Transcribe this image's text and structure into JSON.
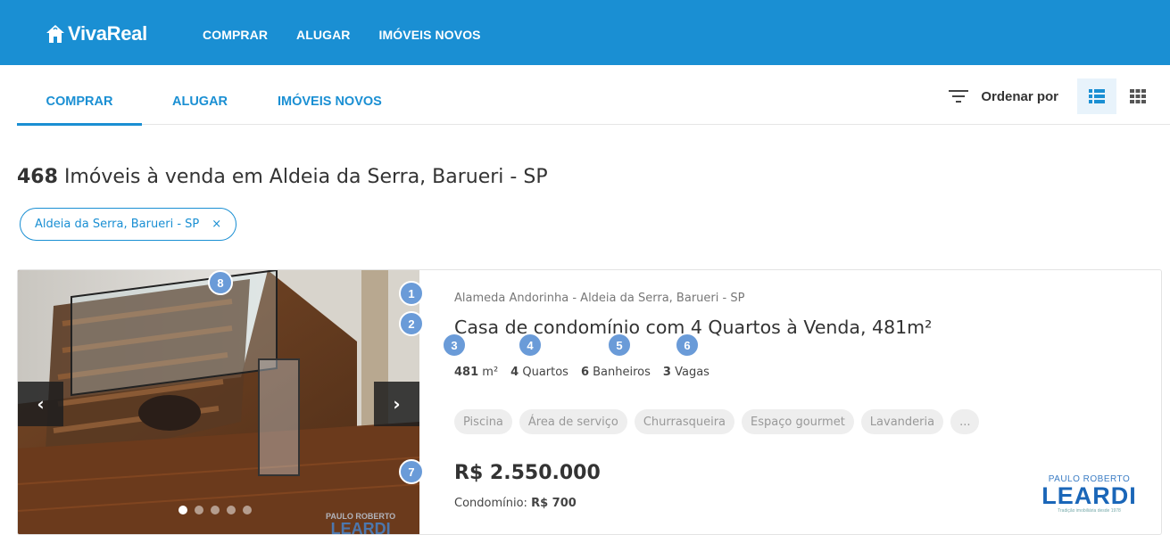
{
  "header": {
    "logo_text": "VivaReal",
    "nav": [
      "COMPRAR",
      "ALUGAR",
      "IMÓVEIS NOVOS"
    ]
  },
  "tabs": [
    {
      "label": "COMPRAR",
      "active": true
    },
    {
      "label": "ALUGAR",
      "active": false
    },
    {
      "label": "IMÓVEIS NOVOS",
      "active": false
    }
  ],
  "toolbar": {
    "sort_label": "Ordenar por",
    "view_modes": [
      "list-view-icon",
      "grid-view-icon"
    ],
    "active_view": "list"
  },
  "results": {
    "count": "468",
    "title_rest": "Imóveis à venda em Aldeia da Serra, Barueri - SP"
  },
  "filter_chip": {
    "label": "Aldeia da Serra, Barueri - SP",
    "remove": "×"
  },
  "listing": {
    "address": "Alameda Andorinha - Aldeia da Serra, Barueri - SP",
    "title": "Casa de condomínio com 4 Quartos à Venda, 481m²",
    "features": [
      {
        "value": "481",
        "unit": "m²"
      },
      {
        "value": "4",
        "unit": "Quartos"
      },
      {
        "value": "6",
        "unit": "Banheiros"
      },
      {
        "value": "3",
        "unit": "Vagas"
      }
    ],
    "amenities": [
      "Piscina",
      "Área de serviço",
      "Churrasqueira",
      "Espaço gourmet",
      "Lavanderia",
      "..."
    ],
    "price": "R$ 2.550.000",
    "condo_label": "Condomínio:",
    "condo_value": "R$ 700",
    "photo_count": 5,
    "photo_index": 1,
    "advertiser": {
      "line1": "PAULO ROBERTO",
      "line2": "LEARDI",
      "tagline": "Tradição imobiliária desde 1978"
    },
    "watermark": {
      "line1": "PAULO ROBERTO",
      "line2": "LEARDI"
    }
  },
  "markers": [
    "1",
    "2",
    "3",
    "4",
    "5",
    "6",
    "7",
    "8"
  ],
  "colors": {
    "brand": "#1a8fd3",
    "marker": "#6a9bd8"
  }
}
